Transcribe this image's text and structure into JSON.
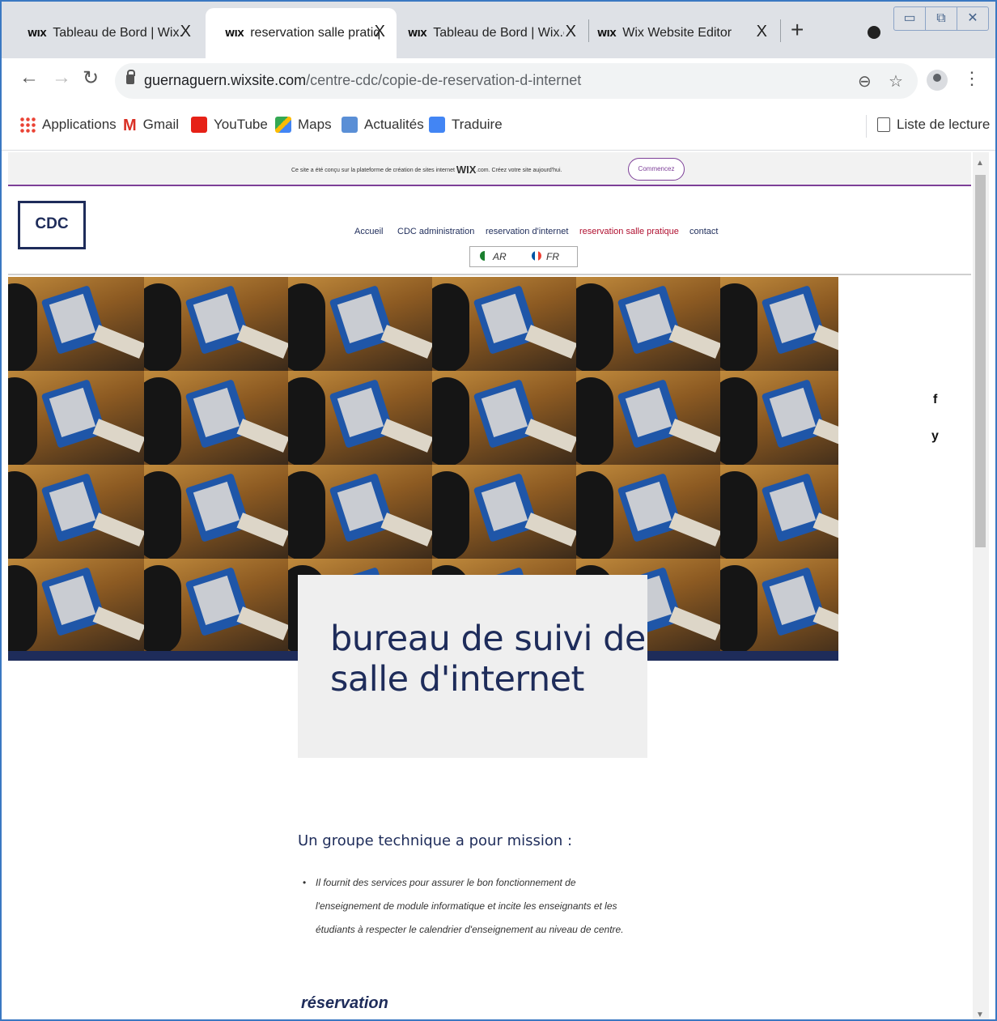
{
  "browser": {
    "tabs": [
      {
        "title": "Tableau de Bord | Wix.com",
        "favicon": "wix-icon",
        "active": false
      },
      {
        "title": "reservation salle pratique",
        "favicon": "wix-icon",
        "active": true
      },
      {
        "title": "Tableau de Bord | Wix.com",
        "favicon": "wix-icon",
        "active": false
      },
      {
        "title": "Wix Website Editor",
        "favicon": "wix-icon",
        "active": false
      }
    ],
    "favicon_text": "WIX",
    "close_glyph": "X",
    "new_tab_glyph": "+",
    "window_buttons": [
      "▭",
      "⧉",
      "✕"
    ],
    "url_host": "guernaguern.wixsite.com",
    "url_path": "/centre-cdc/copie-de-reservation-d-internet",
    "bookmarks": [
      "Applications",
      "Gmail",
      "YouTube",
      "Maps",
      "Actualités",
      "Traduire"
    ],
    "reading_list": "Liste de lecture"
  },
  "wix_banner": {
    "text_before": "Ce site a été conçu sur la plateforme de création de sites internet ",
    "logo": "WIX",
    "text_after": ".com. Créez votre site aujourd'hui.",
    "button": "Commencez"
  },
  "site": {
    "logo": "CDC",
    "nav": [
      "Accueil",
      "CDC administration",
      "reservation d'internet",
      "reservation salle pratique",
      "contact"
    ],
    "current_nav": "reservation salle pratique",
    "languages": [
      "AR",
      "FR"
    ],
    "social": [
      "f",
      "y"
    ],
    "hero_title_line1": "bureau de suivi de",
    "hero_title_line2": "salle d'internet",
    "mission_heading": "Un groupe technique a pour mission :",
    "mission_bullet": "Il fournit des services pour assurer le bon fonctionnement de l'enseignement de module informatique et incite les enseignants et les étudiants à respecter le calendrier d'enseignement au niveau de centre.",
    "reservation_heading": "réservation"
  },
  "colors": {
    "navy": "#1e2c5a",
    "wix_purple": "#7d3f98",
    "active_nav": "#b01030",
    "window_border": "#3a78c2"
  }
}
